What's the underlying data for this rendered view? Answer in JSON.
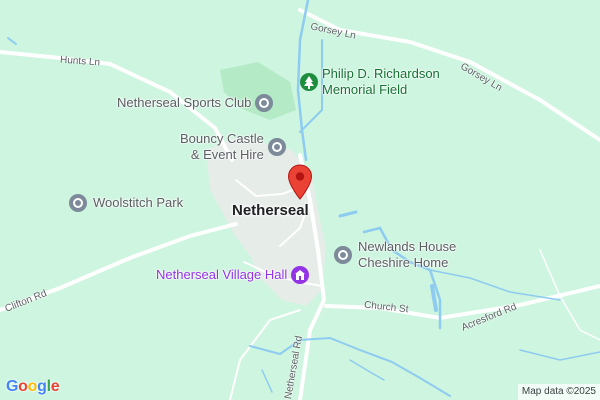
{
  "map": {
    "background": "#cdf5df",
    "town_label": "Netherseal",
    "roads": [
      {
        "name": "Gorsey Ln",
        "id": "gorsey-ln-1"
      },
      {
        "name": "Gorsey Ln",
        "id": "gorsey-ln-2"
      },
      {
        "name": "Hunts Ln",
        "id": "hunts-ln"
      },
      {
        "name": "Clifton Rd",
        "id": "clifton-rd"
      },
      {
        "name": "Church St",
        "id": "church-st"
      },
      {
        "name": "Acresford Rd",
        "id": "acresford-rd"
      },
      {
        "name": "Netherseal Rd",
        "id": "netherseal-rd"
      }
    ],
    "pois": [
      {
        "label": "Philip D. Richardson\nMemorial Field",
        "icon": "park-tree-icon",
        "color": "#1e8e3e",
        "text_color": "green"
      },
      {
        "label": "Netherseal Sports Club",
        "icon": "location-dot-icon",
        "color": "#7c8a99",
        "text_color": "gray"
      },
      {
        "label": "Bouncy Castle\n& Event Hire",
        "icon": "location-dot-icon",
        "color": "#7c8a99",
        "text_color": "gray"
      },
      {
        "label": "Woolstitch Park",
        "icon": "location-dot-icon",
        "color": "#7c8a99",
        "text_color": "gray"
      },
      {
        "label": "Newlands House\nCheshire Home",
        "icon": "location-dot-icon",
        "color": "#7c8a99",
        "text_color": "gray"
      },
      {
        "label": "Netherseal Village Hall",
        "icon": "building-icon",
        "color": "#9334e6",
        "text_color": "purple"
      }
    ],
    "marker": {
      "icon": "red-pin-icon",
      "color": "#ea4335"
    },
    "branding": {
      "logo_text": "Google",
      "logo_letters": [
        {
          "ch": "G",
          "color": "#4285f4"
        },
        {
          "ch": "o",
          "color": "#ea4335"
        },
        {
          "ch": "o",
          "color": "#fbbc05"
        },
        {
          "ch": "g",
          "color": "#4285f4"
        },
        {
          "ch": "l",
          "color": "#34a853"
        },
        {
          "ch": "e",
          "color": "#ea4335"
        }
      ],
      "attribution": "Map data ©2025"
    }
  }
}
